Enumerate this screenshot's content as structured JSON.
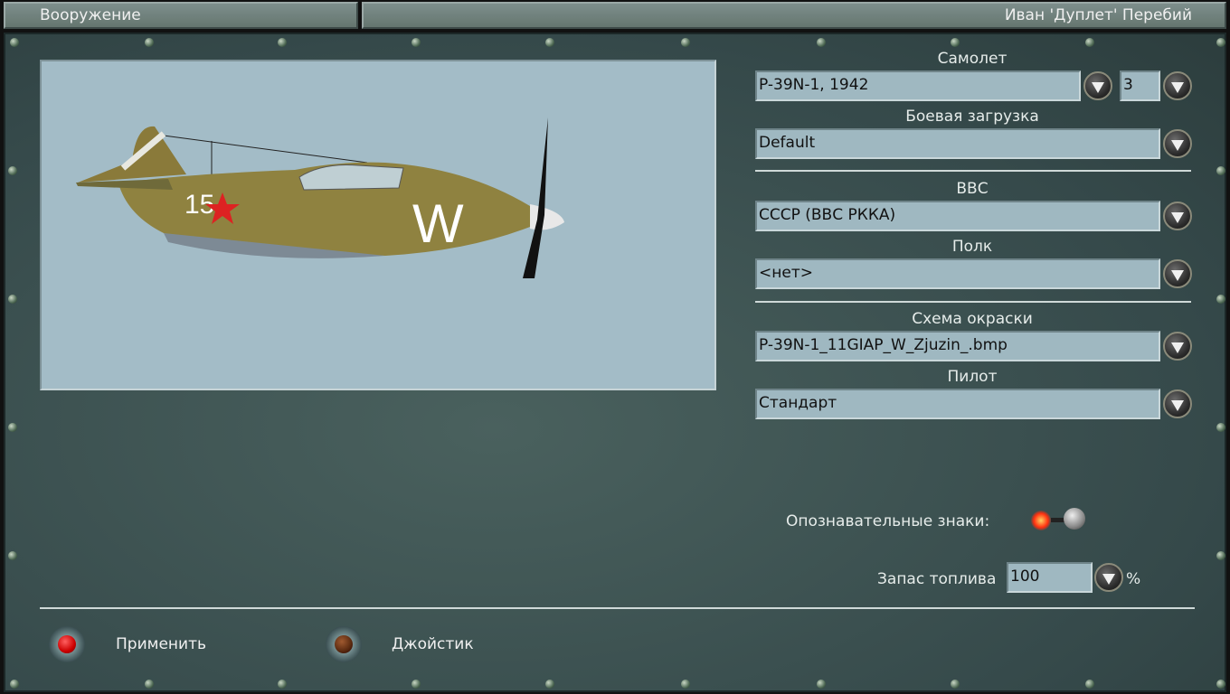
{
  "header": {
    "left_tab": "Вооружение",
    "right_tab": "Иван 'Дуплет' Перебий"
  },
  "aircraft": {
    "label": "Самолет",
    "value": "P-39N-1, 1942",
    "number": "3",
    "tail_number": "15",
    "marking": "W"
  },
  "loadout": {
    "label": "Боевая загрузка",
    "value": "Default"
  },
  "airforce": {
    "label": "ВВС",
    "value": "СССР (ВВС РККА)"
  },
  "regiment": {
    "label": "Полк",
    "value": "<нет>"
  },
  "skin": {
    "label": "Схема окраски",
    "value": "P-39N-1_11GIAP_W_Zjuzin_.bmp"
  },
  "pilot": {
    "label": "Пилот",
    "value": "Стандарт"
  },
  "markings": {
    "label": "Опознавательные знаки:",
    "enabled": true
  },
  "fuel": {
    "label": "Запас топлива",
    "value": "100",
    "unit": "%"
  },
  "buttons": {
    "apply": "Применить",
    "joystick": "Джойстик"
  }
}
